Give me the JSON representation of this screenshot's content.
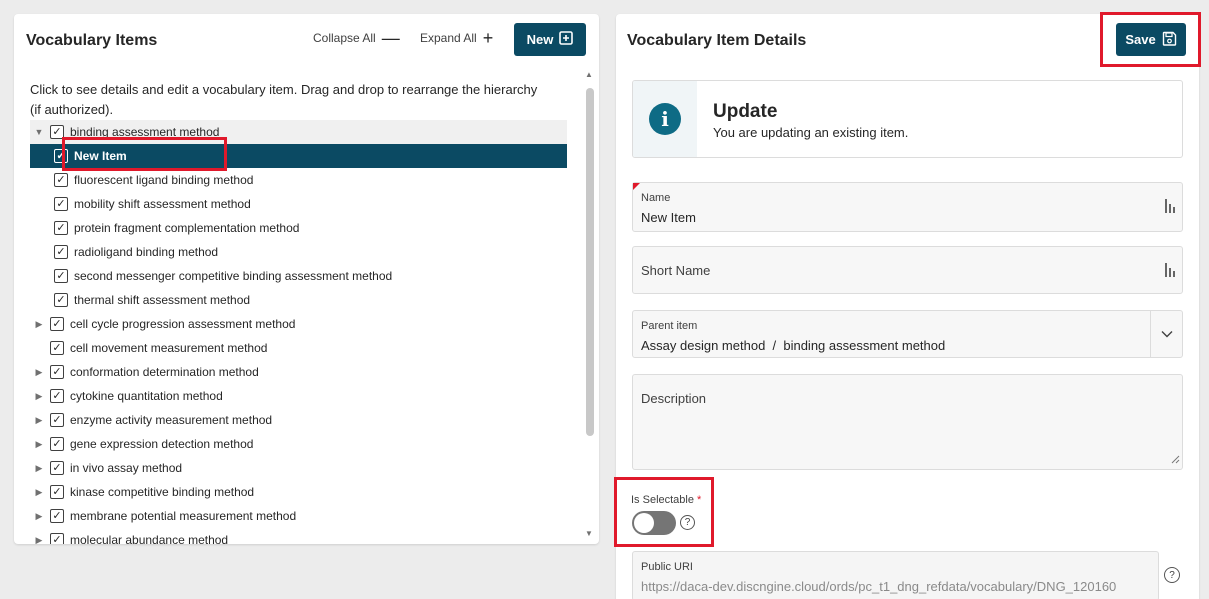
{
  "left_panel": {
    "title": "Vocabulary Items",
    "collapse_all": "Collapse All",
    "expand_all": "Expand All",
    "new_label": "New",
    "description": "Click to see details and edit a vocabulary item. Drag and drop to rearrange the hierarchy (if authorized).",
    "tree": [
      {
        "label": "binding assessment method",
        "level": 0,
        "caret": "expanded",
        "state": "hover"
      },
      {
        "label": "New Item",
        "level": 1,
        "caret": "none",
        "state": "selected"
      },
      {
        "label": "fluorescent ligand binding method",
        "level": 1,
        "caret": "none",
        "state": "normal"
      },
      {
        "label": "mobility shift assessment method",
        "level": 1,
        "caret": "none",
        "state": "normal"
      },
      {
        "label": "protein fragment complementation method",
        "level": 1,
        "caret": "none",
        "state": "normal"
      },
      {
        "label": "radioligand binding method",
        "level": 1,
        "caret": "none",
        "state": "normal"
      },
      {
        "label": "second messenger competitive binding assessment method",
        "level": 1,
        "caret": "none",
        "state": "normal"
      },
      {
        "label": "thermal shift assessment method",
        "level": 1,
        "caret": "none",
        "state": "normal"
      },
      {
        "label": "cell cycle progression assessment method",
        "level": 0,
        "caret": "collapsed",
        "state": "normal"
      },
      {
        "label": "cell movement measurement method",
        "level": 0,
        "caret": "none",
        "state": "normal"
      },
      {
        "label": "conformation determination method",
        "level": 0,
        "caret": "collapsed",
        "state": "normal"
      },
      {
        "label": "cytokine quantitation method",
        "level": 0,
        "caret": "collapsed",
        "state": "normal"
      },
      {
        "label": "enzyme activity measurement method",
        "level": 0,
        "caret": "collapsed",
        "state": "normal"
      },
      {
        "label": "gene expression detection method",
        "level": 0,
        "caret": "collapsed",
        "state": "normal"
      },
      {
        "label": "in vivo assay method",
        "level": 0,
        "caret": "collapsed",
        "state": "normal"
      },
      {
        "label": "kinase competitive binding method",
        "level": 0,
        "caret": "collapsed",
        "state": "normal"
      },
      {
        "label": "membrane potential measurement method",
        "level": 0,
        "caret": "collapsed",
        "state": "normal"
      },
      {
        "label": "molecular abundance method",
        "level": 0,
        "caret": "collapsed",
        "state": "normal"
      }
    ]
  },
  "right_panel": {
    "title": "Vocabulary Item Details",
    "save_label": "Save",
    "info": {
      "title": "Update",
      "text": "You are updating an existing item."
    },
    "name": {
      "label": "Name",
      "value": "New Item"
    },
    "short_name": {
      "label": "Short Name"
    },
    "parent_item": {
      "label": "Parent item",
      "value": "Assay design method  /  binding assessment method"
    },
    "description": {
      "label": "Description"
    },
    "is_selectable": {
      "label": "Is Selectable",
      "required_mark": "*",
      "value": false
    },
    "public_uri": {
      "label": "Public URI",
      "value": "https://daca-dev.discngine.cloud/ords/pc_t1_dng_refdata/vocabulary/DNG_120160"
    }
  },
  "icons": {
    "collapse": "minus-icon",
    "expand": "plus-icon",
    "new": "plus-square-icon",
    "save": "floppy-disk-icon",
    "info": "info-icon",
    "help": "question-circle-icon",
    "chevron": "chevron-down-icon",
    "field_side": "text-length-icon"
  },
  "colors": {
    "accent": "#0b4a63",
    "highlight": "#e0192b",
    "info": "#0e6b85"
  }
}
